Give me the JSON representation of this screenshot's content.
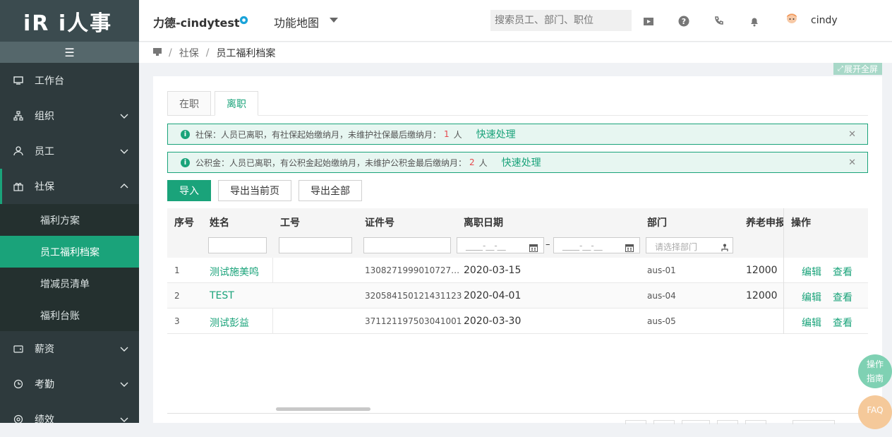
{
  "app": {
    "logo_text": "iR i人事"
  },
  "sidebar": {
    "items": [
      {
        "label": "工作台"
      },
      {
        "label": "组织"
      },
      {
        "label": "员工"
      },
      {
        "label": "社保"
      },
      {
        "label": "薪资"
      },
      {
        "label": "考勤"
      },
      {
        "label": "绩效"
      }
    ],
    "submenu": [
      {
        "label": "福利方案"
      },
      {
        "label": "员工福利档案"
      },
      {
        "label": "增减员清单"
      },
      {
        "label": "福利台账"
      }
    ]
  },
  "header": {
    "company": "力德-cindytest",
    "function_map": "功能地图",
    "search_placeholder": "搜索员工、部门、职位",
    "username": "cindy"
  },
  "breadcrumb": {
    "items": [
      "社保",
      "员工福利档案"
    ]
  },
  "fullscreen_label": "展开全屏",
  "tabs": [
    {
      "label": "在职"
    },
    {
      "label": "离职"
    }
  ],
  "alerts": [
    {
      "text": "社保：人员已离职，有社保起始缴纳月，未维护社保最后缴纳月：",
      "count": "1",
      "unit": "人",
      "action": "快速处理"
    },
    {
      "text": "公积金：人员已离职，有公积金起始缴纳月，未维护公积金最后缴纳月：",
      "count": "2",
      "unit": "人",
      "action": "快速处理"
    }
  ],
  "buttons": {
    "import": "导入",
    "export_page": "导出当前页",
    "export_all": "导出全部"
  },
  "table": {
    "columns": [
      "序号",
      "姓名",
      "工号",
      "证件号",
      "离职日期",
      "部门",
      "养老申报",
      "操作"
    ],
    "filters": {
      "date_placeholder": "____-__-__",
      "date_sep": "–",
      "dept_placeholder": "请选择部门"
    },
    "rows": [
      {
        "no": "1",
        "name": "测试施美鸣",
        "emp_id": "",
        "id_no": "1308271999010727…",
        "leave_date": "2020-03-15",
        "dept": "aus-01",
        "pension": "12000",
        "edit": "编辑",
        "view": "查看"
      },
      {
        "no": "2",
        "name": "TEST",
        "emp_id": "",
        "id_no": "320584150121431123",
        "leave_date": "2020-04-01",
        "dept": "aus-04",
        "pension": "12000",
        "edit": "编辑",
        "view": "查看"
      },
      {
        "no": "3",
        "name": "测试彭益",
        "emp_id": "",
        "id_no": "371121197503041001",
        "leave_date": "2020-03-30",
        "dept": "aus-05",
        "pension": "",
        "edit": "编辑",
        "view": "查看"
      }
    ]
  },
  "floating": {
    "guide": "操作指南",
    "faq": "FAQ"
  },
  "colors": {
    "accent": "#1aa37a",
    "sidebar_bg": "#2e3a3d",
    "alert_count": "#e5484d"
  }
}
